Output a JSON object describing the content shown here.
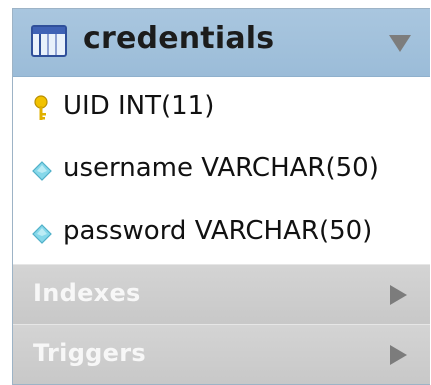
{
  "table": {
    "name": "credentials",
    "icon": "table-grid-icon",
    "collapse_icon": "triangle-down-icon"
  },
  "columns": [
    {
      "text": "UID INT(11)",
      "icon": "primary-key-icon"
    },
    {
      "text": "username VARCHAR(50)",
      "icon": "column-diamond-icon"
    },
    {
      "text": "password VARCHAR(50)",
      "icon": "column-diamond-icon"
    }
  ],
  "sections": [
    {
      "label": "Indexes",
      "icon": "triangle-right-icon"
    },
    {
      "label": "Triggers",
      "icon": "triangle-right-icon"
    }
  ],
  "colors": {
    "header": "#9bbcd8",
    "section": "#cbcbcb",
    "key": "#e8b800",
    "diamond": "#7fd3e6"
  }
}
